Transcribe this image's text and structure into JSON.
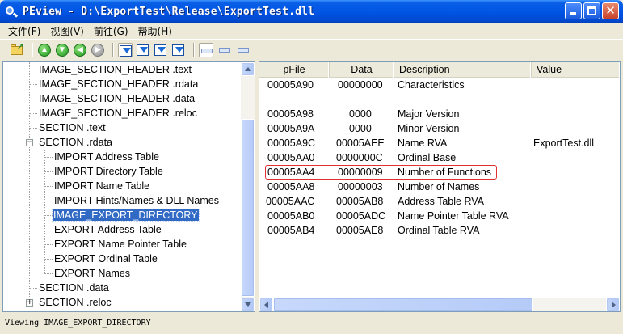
{
  "window": {
    "title": "PEview - D:\\ExportTest\\Release\\ExportTest.dll"
  },
  "menu": [
    "文件(F)",
    "视图(V)",
    "前往(G)",
    "帮助(H)"
  ],
  "tree": [
    {
      "label": "IMAGE_SECTION_HEADER .text"
    },
    {
      "label": "IMAGE_SECTION_HEADER .rdata"
    },
    {
      "label": "IMAGE_SECTION_HEADER .data"
    },
    {
      "label": "IMAGE_SECTION_HEADER .reloc"
    },
    {
      "label": "SECTION .text"
    },
    {
      "label": "SECTION .rdata",
      "expander": "−"
    },
    {
      "label": "IMPORT Address Table"
    },
    {
      "label": "IMPORT Directory Table"
    },
    {
      "label": "IMPORT Name Table"
    },
    {
      "label": "IMPORT Hints/Names & DLL Names"
    },
    {
      "label": "IMAGE_EXPORT_DIRECTORY",
      "selected": true
    },
    {
      "label": "EXPORT Address Table"
    },
    {
      "label": "EXPORT Name Pointer Table"
    },
    {
      "label": "EXPORT Ordinal Table"
    },
    {
      "label": "EXPORT Names"
    },
    {
      "label": "SECTION .data"
    },
    {
      "label": "SECTION .reloc",
      "expander": "+"
    }
  ],
  "list": {
    "columns": [
      "pFile",
      "Data",
      "Description",
      "Value"
    ],
    "rows": [
      {
        "pfile": "00005A90",
        "data": "00000000",
        "desc": "Characteristics",
        "value": ""
      },
      {
        "pfile": "",
        "data": "",
        "desc": "",
        "value": ""
      },
      {
        "pfile": "00005A98",
        "data": "0000",
        "desc": "Major Version",
        "value": ""
      },
      {
        "pfile": "00005A9A",
        "data": "0000",
        "desc": "Minor Version",
        "value": ""
      },
      {
        "pfile": "00005A9C",
        "data": "00005AEE",
        "desc": "Name RVA",
        "value": "ExportTest.dll"
      },
      {
        "pfile": "00005AA0",
        "data": "0000000C",
        "desc": "Ordinal Base",
        "value": ""
      },
      {
        "pfile": "00005AA4",
        "data": "00000009",
        "desc": "Number of Functions",
        "value": "",
        "highlighted": true
      },
      {
        "pfile": "00005AA8",
        "data": "00000003",
        "desc": "Number of Names",
        "value": ""
      },
      {
        "pfile": "00005AAC",
        "data": "00005AB8",
        "desc": "Address Table RVA",
        "value": ""
      },
      {
        "pfile": "00005AB0",
        "data": "00005ADC",
        "desc": "Name Pointer Table RVA",
        "value": ""
      },
      {
        "pfile": "00005AB4",
        "data": "00005AE8",
        "desc": "Ordinal Table RVA",
        "value": ""
      }
    ]
  },
  "status": {
    "text": "Viewing IMAGE_EXPORT_DIRECTORY"
  }
}
